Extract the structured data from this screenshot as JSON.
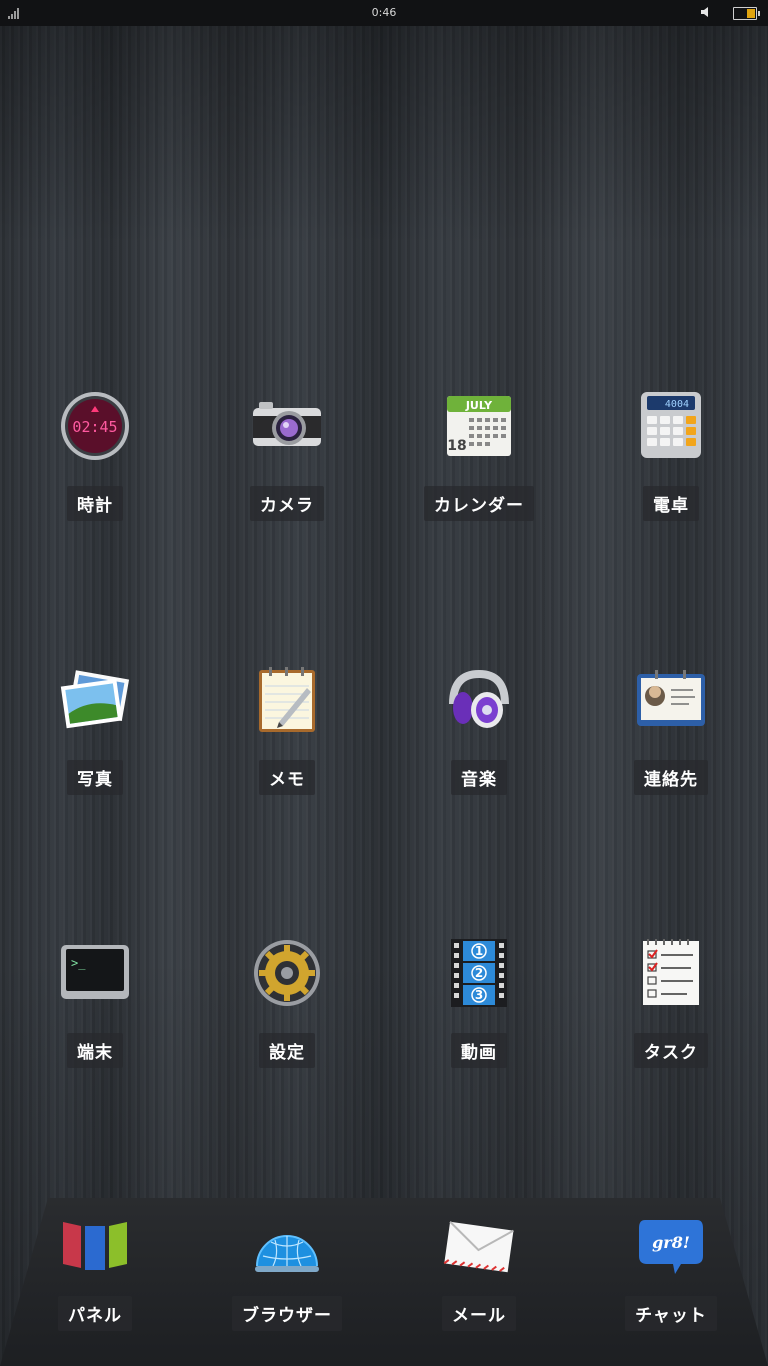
{
  "status_bar": {
    "time": "0:46"
  },
  "apps": [
    {
      "name": "app-clock",
      "label": "時計",
      "icon": "clock-icon",
      "clock_text": "02:45"
    },
    {
      "name": "app-camera",
      "label": "カメラ",
      "icon": "camera-icon"
    },
    {
      "name": "app-calendar",
      "label": "カレンダー",
      "icon": "calendar-icon",
      "month": "JULY",
      "day": "18"
    },
    {
      "name": "app-calculator",
      "label": "電卓",
      "icon": "calculator-icon",
      "display": "4004"
    },
    {
      "name": "app-photos",
      "label": "写真",
      "icon": "photos-icon"
    },
    {
      "name": "app-memo",
      "label": "メモ",
      "icon": "notepad-icon"
    },
    {
      "name": "app-music",
      "label": "音楽",
      "icon": "headphones-icon"
    },
    {
      "name": "app-contacts",
      "label": "連絡先",
      "icon": "contact-card-icon"
    },
    {
      "name": "app-terminal",
      "label": "端末",
      "icon": "terminal-icon",
      "prompt": ">_"
    },
    {
      "name": "app-settings",
      "label": "設定",
      "icon": "gear-icon"
    },
    {
      "name": "app-video",
      "label": "動画",
      "icon": "film-strip-icon"
    },
    {
      "name": "app-tasks",
      "label": "タスク",
      "icon": "checklist-icon"
    }
  ],
  "dock": [
    {
      "name": "dock-panel",
      "label": "パネル",
      "icon": "panels-icon"
    },
    {
      "name": "dock-browser",
      "label": "ブラウザー",
      "icon": "globe-icon"
    },
    {
      "name": "dock-mail",
      "label": "メール",
      "icon": "envelope-icon"
    },
    {
      "name": "dock-chat",
      "label": "チャット",
      "icon": "chat-bubble-icon",
      "bubble_text": "gr8!"
    }
  ]
}
